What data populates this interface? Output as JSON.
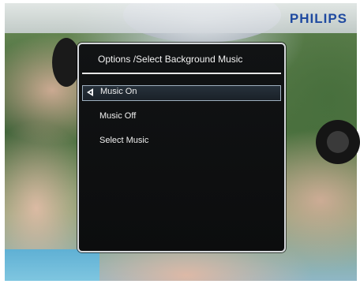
{
  "brand": {
    "name": "PHILIPS",
    "color": "#1f4aa0"
  },
  "dialog": {
    "title": "Options /Select Background Music",
    "selected_index": 0,
    "items": [
      {
        "label": "Music On",
        "selected": true,
        "icon": "left-arrow-icon"
      },
      {
        "label": "Music Off",
        "selected": false
      },
      {
        "label": "Select Music",
        "selected": false
      }
    ]
  },
  "colors": {
    "dialog_background": "#0e0f10",
    "dialog_border": "#d6d9dc",
    "highlight_border": "#9fb0bf",
    "text": "#f0f0f0"
  }
}
